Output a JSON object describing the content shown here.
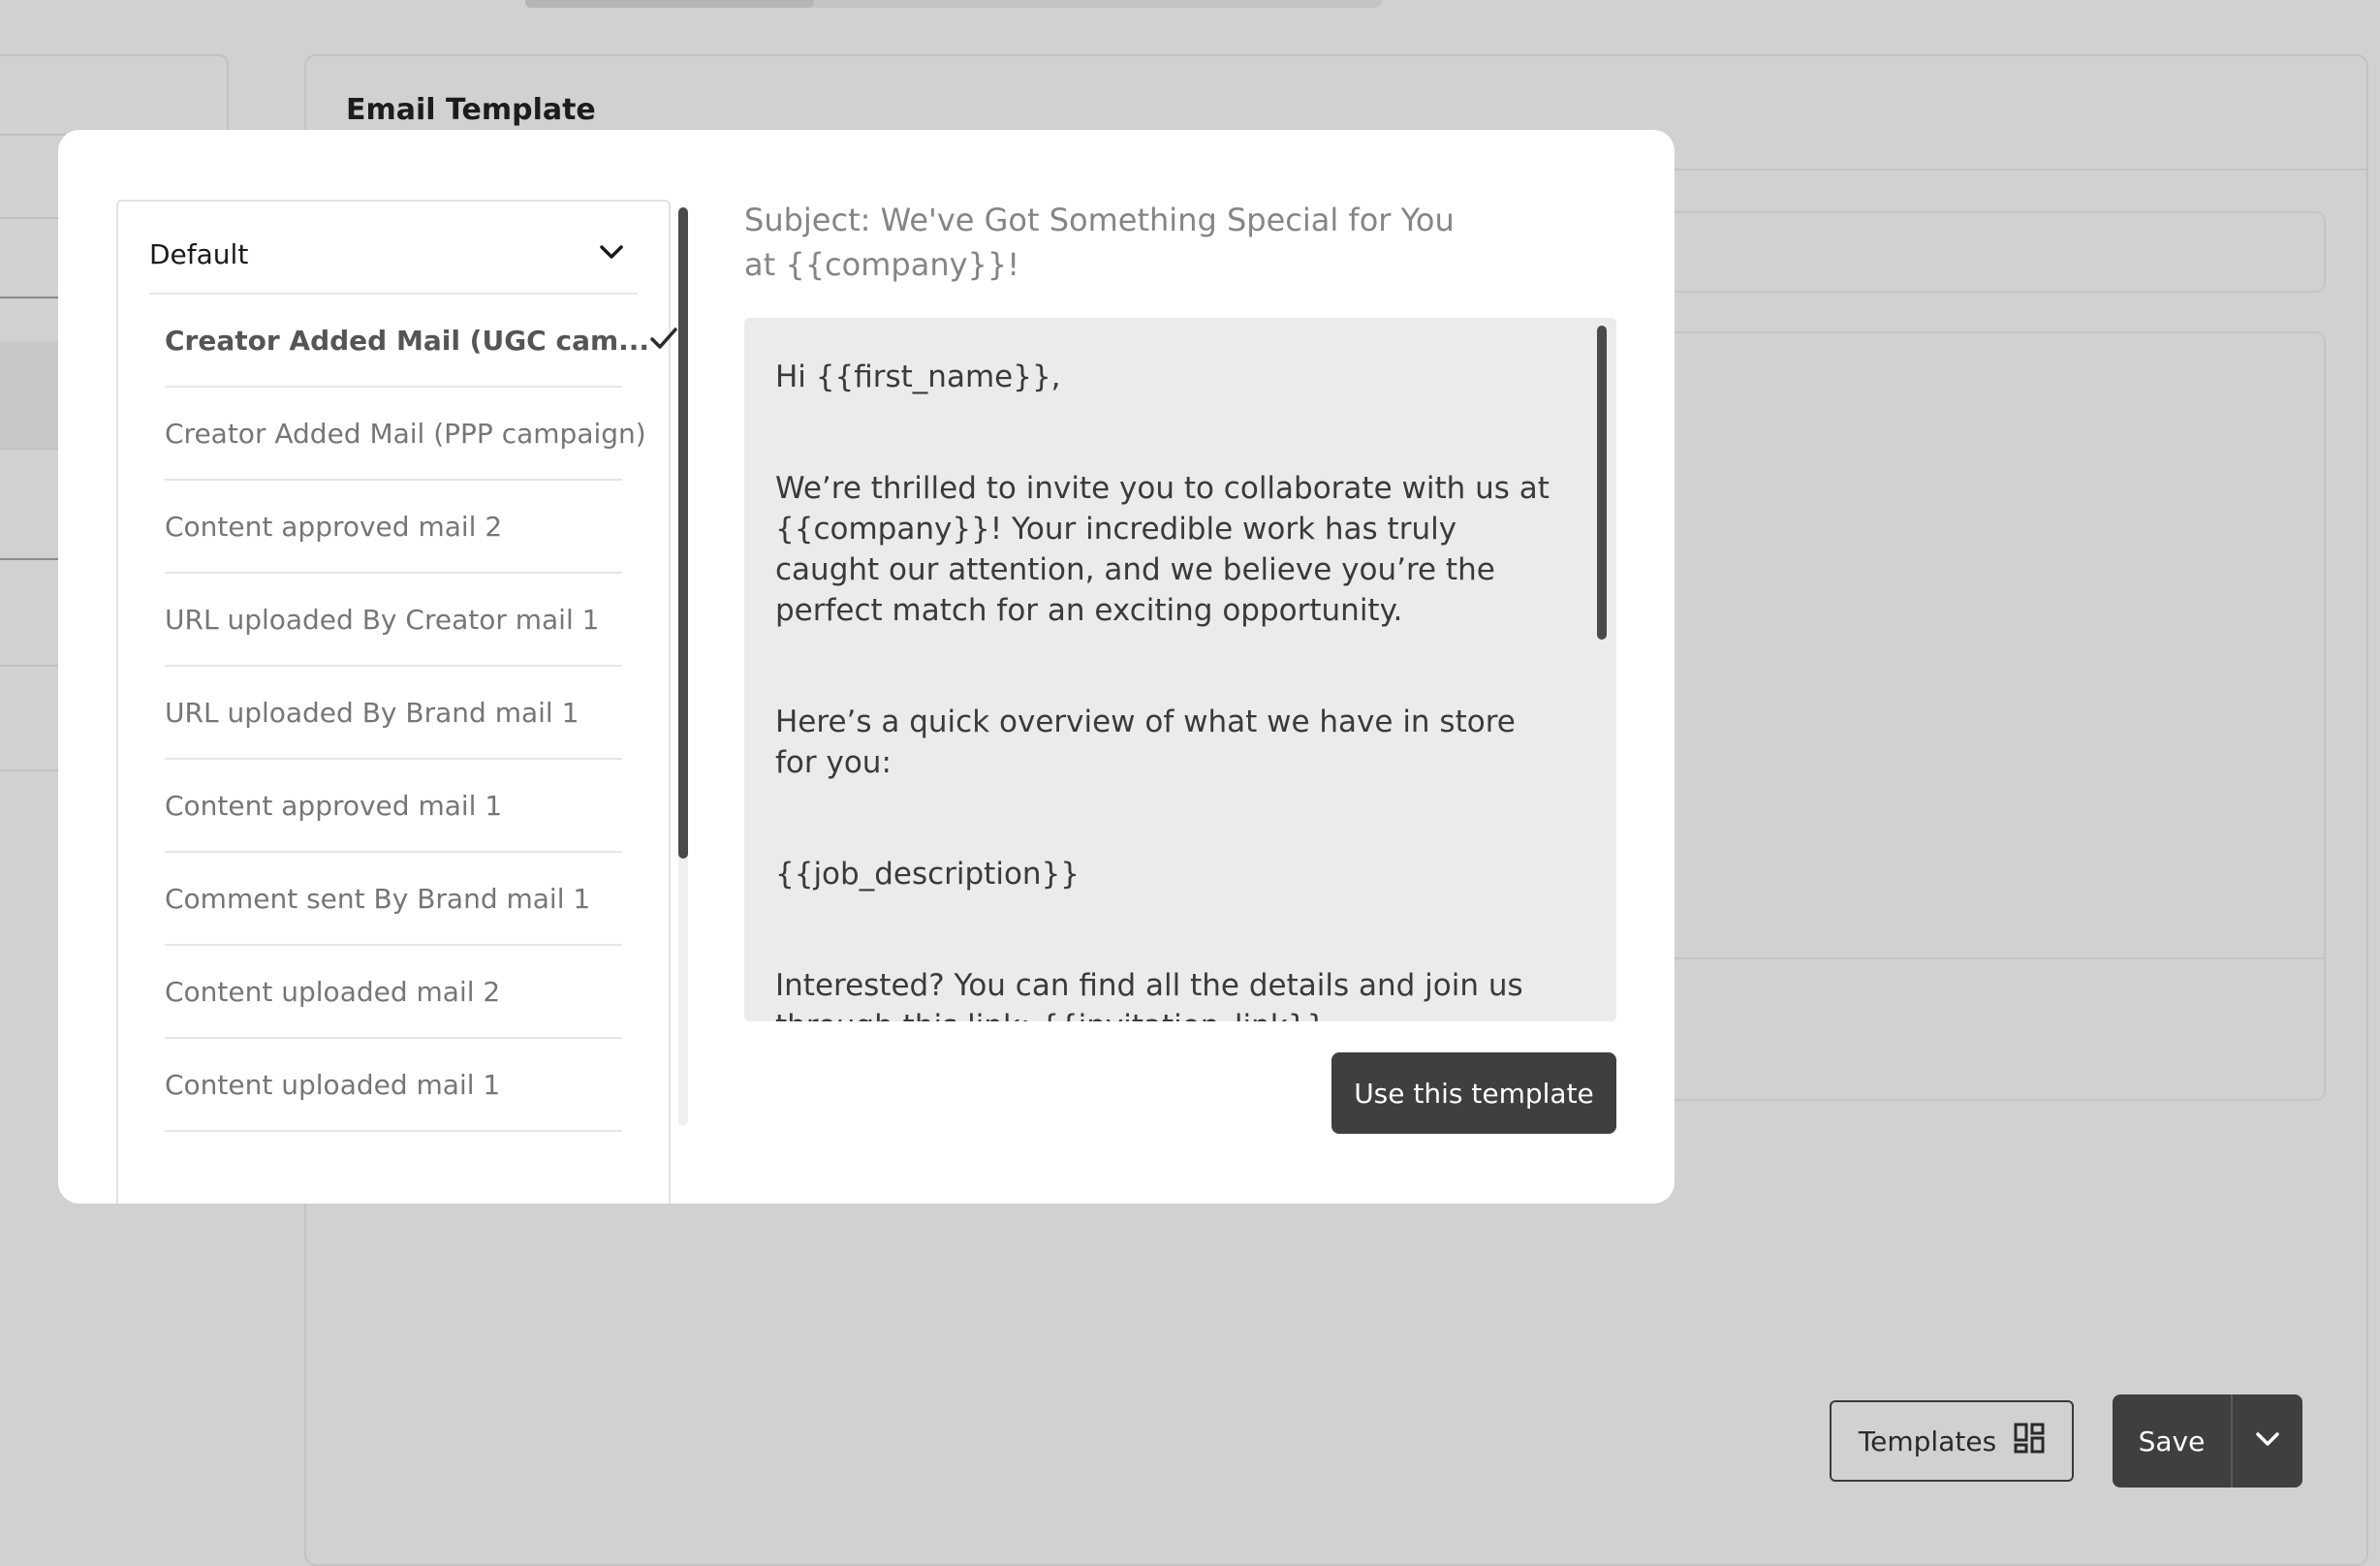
{
  "background": {
    "section_title": "Email Template",
    "templates_button_label": "Templates",
    "save_button_label": "Save"
  },
  "modal": {
    "category_dropdown": {
      "selected": "Default"
    },
    "templates": [
      {
        "label": "Creator Added Mail (UGC cam...",
        "selected": true
      },
      {
        "label": "Creator Added Mail (PPP campaign)",
        "selected": false
      },
      {
        "label": "Content approved mail 2",
        "selected": false
      },
      {
        "label": "URL uploaded By Creator mail 1",
        "selected": false
      },
      {
        "label": "URL uploaded By Brand mail 1",
        "selected": false
      },
      {
        "label": "Content approved mail 1",
        "selected": false
      },
      {
        "label": "Comment sent By Brand mail 1",
        "selected": false
      },
      {
        "label": "Content uploaded mail 2",
        "selected": false
      },
      {
        "label": "Content uploaded mail 1",
        "selected": false
      }
    ],
    "preview": {
      "subject": "Subject: We've Got Something Special for You at {{company}}!",
      "paragraphs": [
        "Hi {{first_name}},",
        "We’re thrilled to invite you to collaborate with us at {{company}}! Your incredible work has truly caught our attention, and we believe you’re the perfect match for an exciting opportunity.",
        "Here’s a quick overview of what we have in store for you:",
        "{{job_description}}",
        "Interested? You can find all the details and join us through this link: {{invitation_link}}"
      ]
    },
    "use_template_button_label": "Use this template"
  },
  "colors": {
    "overlay_background": "#d1d1d1",
    "modal_background": "#ffffff",
    "primary_button": "#3f3f3f",
    "preview_background": "#ebebeb"
  }
}
